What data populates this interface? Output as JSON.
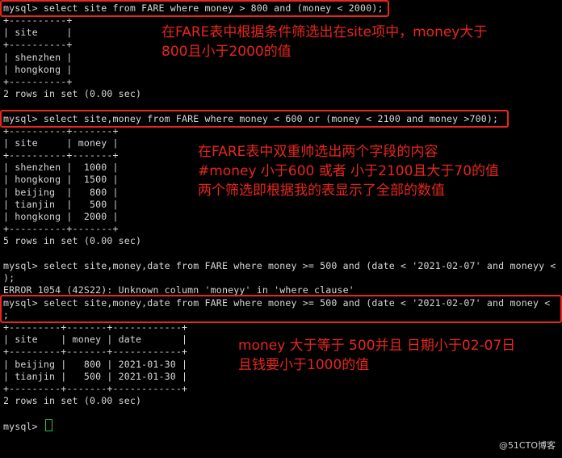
{
  "terminal": {
    "lines": [
      "mysql> select site from FARE where money > 800 and (money < 2000);",
      "+----------+",
      "| site     |",
      "+----------+",
      "| shenzhen |",
      "| hongkong |",
      "+----------+",
      "2 rows in set (0.00 sec)",
      "",
      "mysql> select site,money from FARE where money < 600 or (money < 2100 and money >700);",
      "+----------+-------+",
      "| site     | money |",
      "+----------+-------+",
      "| shenzhen |  1000 |",
      "| hongkong |  1500 |",
      "| beijing  |   800 |",
      "| tianjin  |   500 |",
      "| hongkong |  2000 |",
      "+----------+-------+",
      "5 rows in set (0.00 sec)",
      "",
      "mysql> select site,money,date from FARE where money >= 500 and (date < '2021-02-07' and moneyy <",
      ");",
      "ERROR 1054 (42S22): Unknown column 'moneyy' in 'where clause'",
      "mysql> select site,money,date from FARE where money >= 500 and (date < '2021-02-07' and money <",
      ";",
      "+---------+-------+------------+",
      "| site    | money | date       |",
      "+---------+-------+------------+",
      "| beijing |   800 | 2021-01-30 |",
      "| tianjin |   500 | 2021-01-30 |",
      "+---------+-------+------------+",
      "2 rows in set (0.00 sec)",
      "",
      "mysql> "
    ],
    "prompt": "mysql>"
  },
  "annotations": [
    {
      "text": "在FARE表中根据条件筛选出在site项中，money大于\n800且小于2000的值"
    },
    {
      "text": "在FARE表中双重帅选出两个字段的内容\n#money 小于600 或者 小于2100且大于70的值\n两个筛选即根据我的表显示了全部的数值"
    },
    {
      "text": "money 大于等于 500并且 日期小于02-07日\n且钱要小于1000的值"
    }
  ],
  "watermark": "@51CTO博客",
  "colors": {
    "highlight": "#e8261e",
    "cursor": "#2fbf3a",
    "text": "#d8d8d8"
  }
}
